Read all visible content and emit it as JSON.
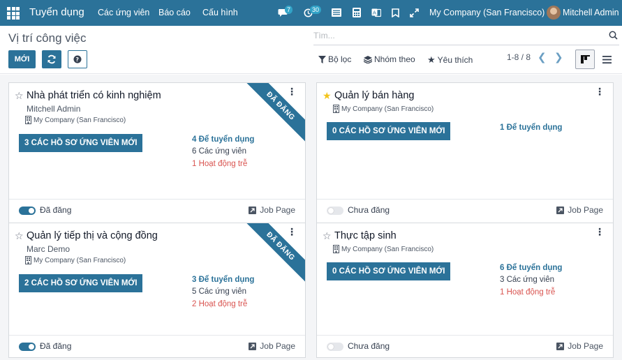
{
  "app": {
    "title": "Tuyển dụng"
  },
  "menu": [
    "Các ứng viên",
    "Báo cáo",
    "Cấu hình"
  ],
  "systray": {
    "messages_count": "7",
    "activities_count": "30",
    "company": "My Company (San Francisco)",
    "user": "Mitchell Admin"
  },
  "control": {
    "page_title": "Vị trí công việc",
    "search_placeholder": "Tìm...",
    "new_label": "MỚI",
    "filter_label": "Bộ lọc",
    "groupby_label": "Nhóm theo",
    "favorites_label": "Yêu thích",
    "pager": "1-8 / 8"
  },
  "jobs": [
    {
      "title": "Nhà phát triển có kinh nghiệm",
      "owner": "Mitchell Admin",
      "company": "My Company (San Francisco)",
      "favorite": false,
      "ribbon": "ĐÃ ĐĂNG",
      "new_apps": "3 CÁC HỒ SƠ ỨNG VIÊN MỚI",
      "to_recruit": "4 Để tuyển dụng",
      "applicants": "6 Các ứng viên",
      "late": "1 Hoạt động trễ",
      "published_label": "Đã đăng",
      "published": true,
      "job_page": "Job Page"
    },
    {
      "title": "Quản lý bán hàng",
      "owner": "",
      "company": "My Company (San Francisco)",
      "favorite": true,
      "ribbon": "",
      "new_apps": "0 CÁC HỒ SƠ ỨNG VIÊN MỚI",
      "to_recruit": "1 Để tuyển dụng",
      "applicants": "",
      "late": "",
      "published_label": "Chưa đăng",
      "published": false,
      "job_page": "Job Page"
    },
    {
      "title": "Quản lý tiếp thị và cộng đồng",
      "owner": "Marc Demo",
      "company": "My Company (San Francisco)",
      "favorite": false,
      "ribbon": "ĐÃ ĐĂNG",
      "new_apps": "2 CÁC HỒ SƠ ỨNG VIÊN MỚI",
      "to_recruit": "3 Để tuyển dụng",
      "applicants": "5 Các ứng viên",
      "late": "2 Hoạt động trễ",
      "published_label": "Đã đăng",
      "published": true,
      "job_page": "Job Page"
    },
    {
      "title": "Thực tập sinh",
      "owner": "",
      "company": "My Company (San Francisco)",
      "favorite": false,
      "ribbon": "",
      "new_apps": "0 CÁC HỒ SƠ ỨNG VIÊN MỚI",
      "to_recruit": "6 Để tuyển dụng",
      "applicants": "3 Các ứng viên",
      "late": "1 Hoạt động trễ",
      "published_label": "Chưa đăng",
      "published": false,
      "job_page": "Job Page"
    }
  ],
  "colors": {
    "primary": "#2b7299",
    "late": "#d9534f",
    "favorite": "#f3c41a"
  }
}
